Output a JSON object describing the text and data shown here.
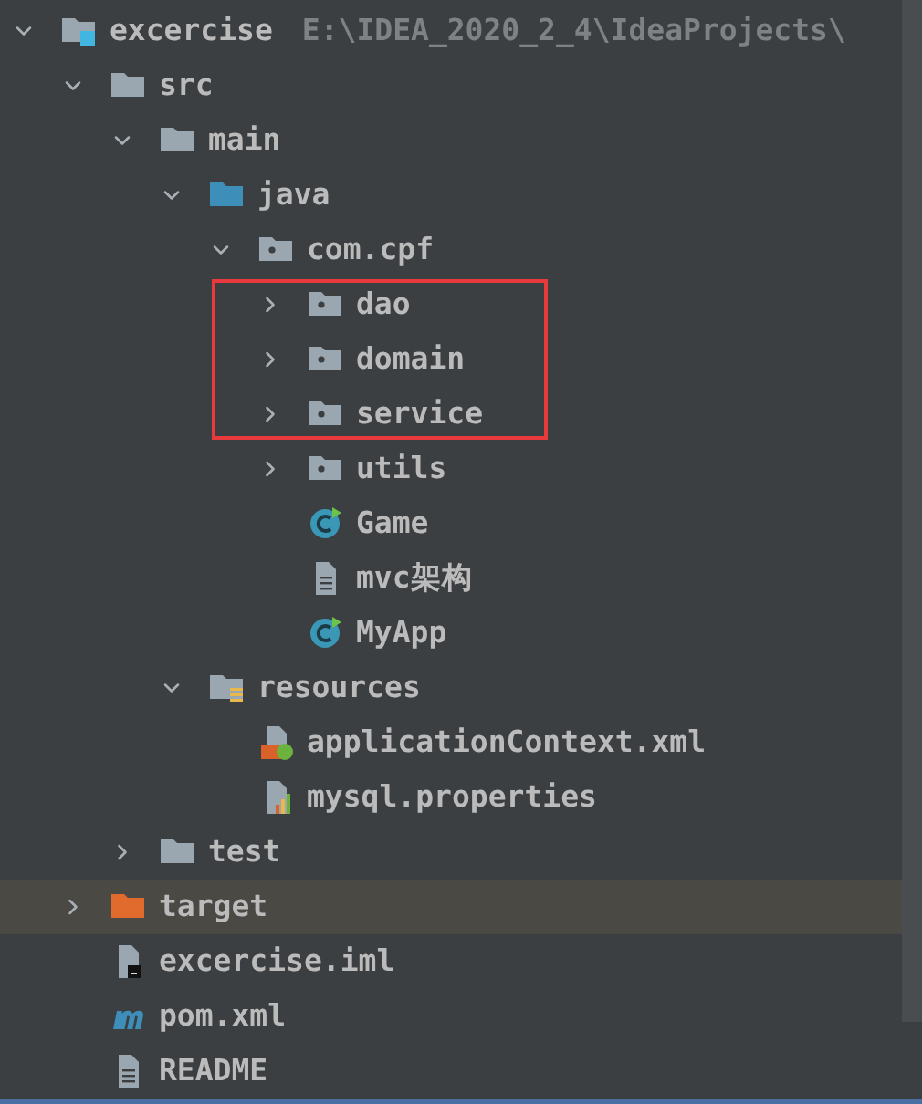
{
  "tree": [
    {
      "name": "excercise",
      "path": "E:\\IDEA_2020_2_4\\IdeaProjects\\",
      "kind": "module",
      "expanded": true,
      "selected": false,
      "children": [
        {
          "name": "src",
          "kind": "folder",
          "expanded": true,
          "selected": false,
          "children": [
            {
              "name": "main",
              "kind": "folder",
              "expanded": true,
              "selected": false,
              "children": [
                {
                  "name": "java",
                  "kind": "source",
                  "expanded": true,
                  "selected": false,
                  "children": [
                    {
                      "name": "com.cpf",
                      "kind": "package",
                      "expanded": true,
                      "selected": false,
                      "children": [
                        {
                          "name": "dao",
                          "kind": "package",
                          "expanded": false,
                          "selected": false,
                          "boxed": true
                        },
                        {
                          "name": "domain",
                          "kind": "package",
                          "expanded": false,
                          "selected": false,
                          "boxed": true
                        },
                        {
                          "name": "service",
                          "kind": "package",
                          "expanded": false,
                          "selected": false,
                          "boxed": true
                        },
                        {
                          "name": "utils",
                          "kind": "package",
                          "expanded": false,
                          "selected": false,
                          "boxed": false
                        },
                        {
                          "name": "Game",
                          "kind": "class",
                          "selected": false,
                          "boxed": false
                        },
                        {
                          "name": "mvc架构",
                          "kind": "text",
                          "selected": false,
                          "boxed": false
                        },
                        {
                          "name": "MyApp",
                          "kind": "class",
                          "selected": false,
                          "boxed": false
                        }
                      ]
                    }
                  ]
                },
                {
                  "name": "resources",
                  "kind": "resources",
                  "expanded": true,
                  "selected": false,
                  "children": [
                    {
                      "name": "applicationContext.xml",
                      "kind": "spring",
                      "selected": false
                    },
                    {
                      "name": "mysql.properties",
                      "kind": "properties",
                      "selected": false
                    }
                  ]
                }
              ]
            },
            {
              "name": "test",
              "kind": "folder",
              "expanded": false,
              "selected": false
            }
          ]
        },
        {
          "name": "target",
          "kind": "excluded",
          "expanded": false,
          "selected": true
        },
        {
          "name": "excercise.iml",
          "kind": "iml",
          "selected": false
        },
        {
          "name": "pom.xml",
          "kind": "maven",
          "selected": false
        },
        {
          "name": "README",
          "kind": "text",
          "selected": false
        }
      ]
    }
  ]
}
